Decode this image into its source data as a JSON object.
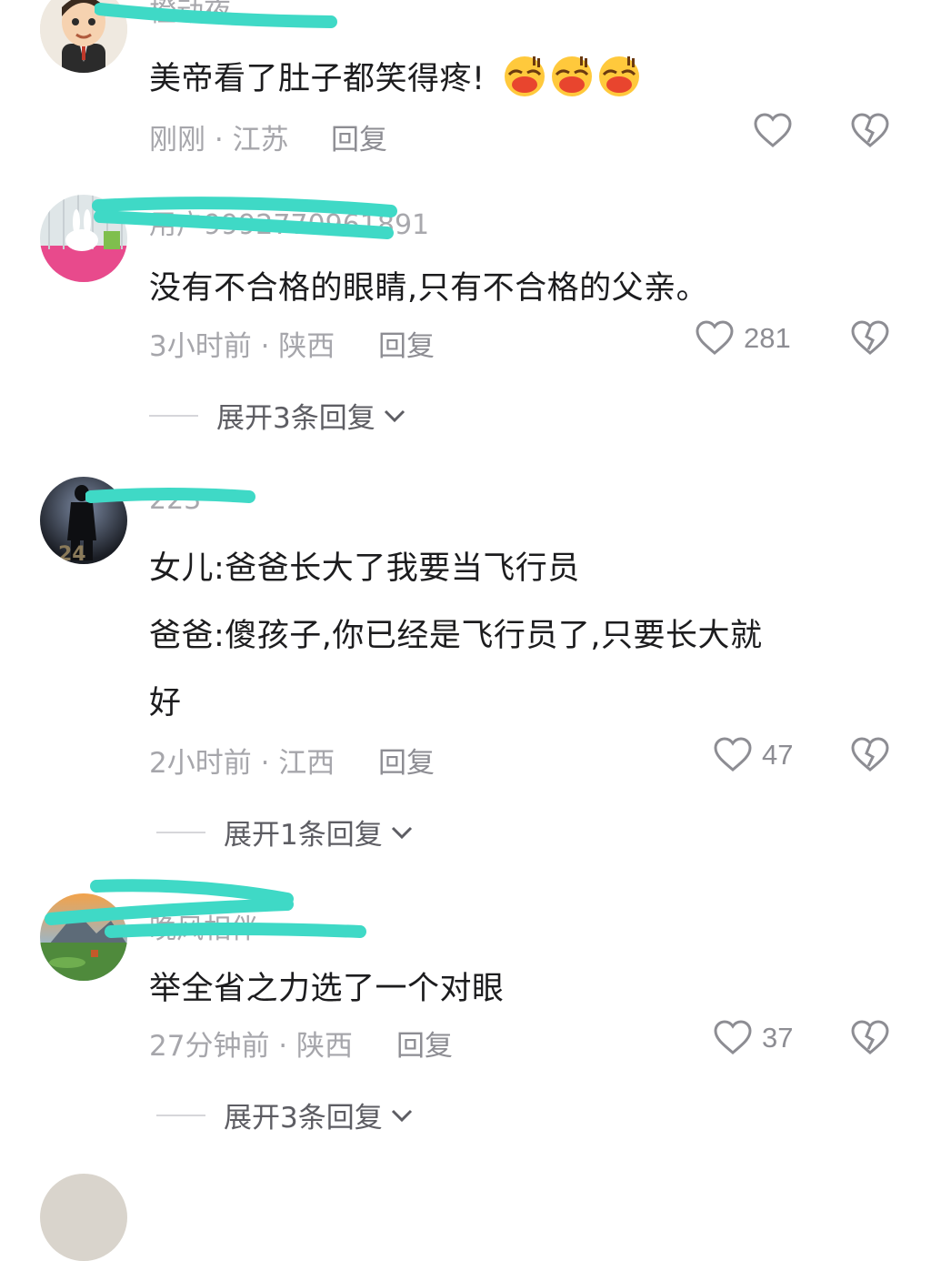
{
  "comments": [
    {
      "username": "橙动夜。",
      "text_lines": [
        "美帝看了肚子都笑得疼!"
      ],
      "emoji": [
        "laughing-emoji",
        "laughing-emoji",
        "laughing-emoji"
      ],
      "time": "刚刚",
      "location": "江苏",
      "reply_label": "回复",
      "likes": "",
      "expand_label": ""
    },
    {
      "username": "用户9992770961891",
      "text_lines": [
        "没有不合格的眼睛,只有不合格的父亲。"
      ],
      "time": "3小时前",
      "location": "陕西",
      "reply_label": "回复",
      "likes": "281",
      "expand_label": "展开3条回复"
    },
    {
      "username": "223",
      "text_lines": [
        "女儿:爸爸长大了我要当飞行员",
        "爸爸:傻孩子,你已经是飞行员了,只要长大就",
        "好"
      ],
      "time": "2小时前",
      "location": "江西",
      "reply_label": "回复",
      "likes": "47",
      "expand_label": "展开1条回复"
    },
    {
      "username": "晚风相伴",
      "text_lines": [
        "举全省之力选了一个对眼"
      ],
      "time": "27分钟前",
      "location": "陕西",
      "reply_label": "回复",
      "likes": "37",
      "expand_label": "展开3条回复"
    }
  ],
  "separator": " · ",
  "colors": {
    "redaction": "#3fd9c6",
    "muted_text": "#a6a6ab",
    "body_text": "#1c1c1e"
  }
}
